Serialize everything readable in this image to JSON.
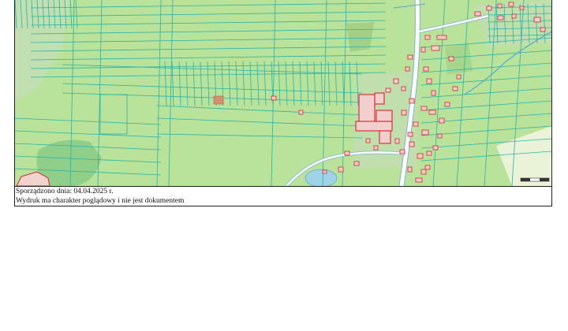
{
  "map": {
    "colors": {
      "land": "#b9e39a",
      "parcel_line": "#28b4a8",
      "road": "#ffffff",
      "road_edge": "#7fb3cf",
      "building": "#e8b0b0",
      "building_edge": "#d9232a",
      "forest": "#8fcf8a",
      "water": "#9fd3e8",
      "highlight_parcel": "#d49070"
    },
    "scale_bar": "scale-bar-icon",
    "north_label": ""
  },
  "footer": {
    "line1": "Sporządzono dnia: 04.04.2025 r.",
    "line2": "Wydruk ma charakter poglądowy i nie jest dokumentem"
  }
}
